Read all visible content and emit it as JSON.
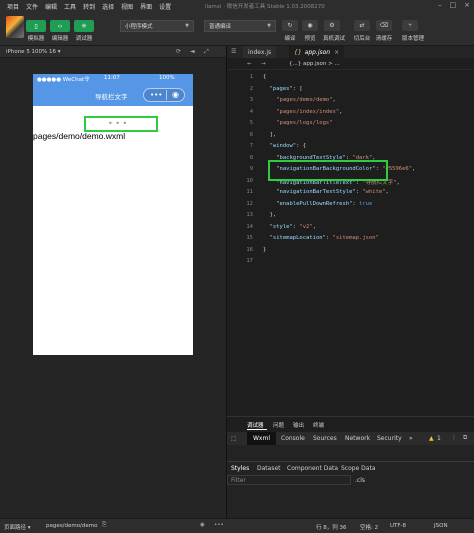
{
  "menubar": {
    "items": [
      "项目",
      "文件",
      "编辑",
      "工具",
      "转到",
      "选择",
      "视图",
      "界面",
      "设置"
    ],
    "window_title": "ilamxi · 微信开发者工具 Stable 1.03.2008270"
  },
  "toolbar": {
    "left_buttons": [
      {
        "label": "模拟器",
        "icon": "phone-icon"
      },
      {
        "label": "编辑器",
        "icon": "code-icon"
      },
      {
        "label": "调试器",
        "icon": "bug-icon"
      }
    ],
    "mode_select": "小程序模式",
    "compile_select": "普通编译",
    "right_buttons": [
      {
        "label": "编译",
        "icon": "refresh-icon"
      },
      {
        "label": "预览",
        "icon": "eye-icon"
      },
      {
        "label": "真机调试",
        "icon": "debug-icon"
      },
      {
        "label": "切后台",
        "icon": "switch-icon"
      },
      {
        "label": "清缓存",
        "icon": "clean-icon"
      },
      {
        "label": "版本管理",
        "icon": "branch-icon"
      }
    ]
  },
  "simulator": {
    "device": "iPhone 5 100% 16 ▾",
    "status_left": "●●●●● WeChat令",
    "status_time": "11:07",
    "status_right": "100%",
    "nav_title": "导航栏文字",
    "loading_dots": "• • •",
    "page_path_text": "pages/demo/demo.wxml"
  },
  "editor": {
    "tabs": [
      {
        "label": "index.js",
        "active": false
      },
      {
        "label": "app.json",
        "active": true
      }
    ],
    "breadcrumb": "{...} app.json > ...",
    "lines": [
      {
        "n": "1",
        "text": "{"
      },
      {
        "n": "2",
        "text": "  \"pages\": ["
      },
      {
        "n": "3",
        "text": "    \"pages/demo/demo\","
      },
      {
        "n": "4",
        "text": "    \"pages/index/index\","
      },
      {
        "n": "5",
        "text": "    \"pages/logs/logs\""
      },
      {
        "n": "6",
        "text": "  ],"
      },
      {
        "n": "7",
        "text": "  \"window\": {"
      },
      {
        "n": "8",
        "text": "    \"backgroundTextStyle\": \"dark\","
      },
      {
        "n": "9",
        "text": "    \"navigationBarBackgroundColor\": \"#5596e6\","
      },
      {
        "n": "10",
        "text": "    \"navigationBarTitleText\": \"导航栏文字\","
      },
      {
        "n": "11",
        "text": "    \"navigationBarTextStyle\": \"white\","
      },
      {
        "n": "12",
        "text": "    \"enablePullDownRefresh\": true"
      },
      {
        "n": "13",
        "text": "  },"
      },
      {
        "n": "14",
        "text": "  \"style\": \"v2\","
      },
      {
        "n": "15",
        "text": "  \"sitemapLocation\": \"sitemap.json\""
      },
      {
        "n": "16",
        "text": "}"
      },
      {
        "n": "17",
        "text": ""
      }
    ]
  },
  "devtools": {
    "top_tabs": [
      "调试器",
      "问题",
      "输出",
      "终端"
    ],
    "panel_tabs": [
      "Wxml",
      "Console",
      "Sources",
      "Network",
      "Security",
      "»"
    ],
    "warning_count": "1",
    "sub_tabs": [
      "Styles",
      "Dataset",
      "Component Data",
      "Scope Data"
    ],
    "filter_placeholder": "Filter",
    "cls_label": ".cls"
  },
  "statusbar": {
    "path_label": "页面路径 ▾",
    "path_value": "pages/demo/demo",
    "position": "行 8，列 36",
    "spaces": "空格: 2",
    "encoding": "UTF-8",
    "language": "JSON"
  }
}
